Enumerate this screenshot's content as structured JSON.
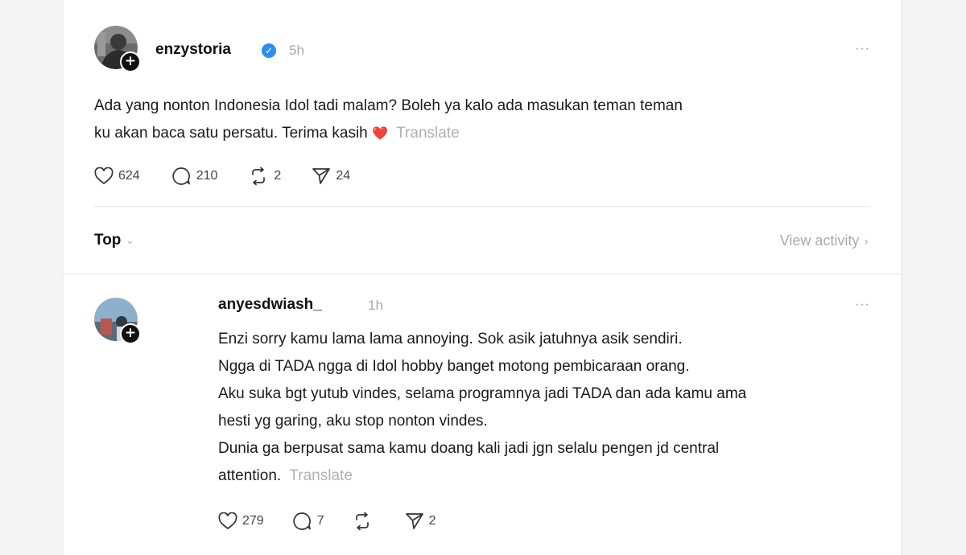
{
  "post": {
    "username": "enzystoria",
    "time": "5h",
    "text_lines": [
      "Ada yang nonton Indonesia Idol tadi malam? Boleh ya kalo ada masukan teman teman",
      "ku akan baca satu persatu. Terima kasih"
    ],
    "heart_emoji": "❤️",
    "translate": "Translate",
    "likes": "624",
    "replies": "210",
    "reposts": "2",
    "shares": "24",
    "more": "···"
  },
  "sort": {
    "label": "Top",
    "chevron": "⌵"
  },
  "view_activity": {
    "label": "View activity",
    "chevron": "›"
  },
  "reply": {
    "username": "anyesdwiash_",
    "time": "1h",
    "text_lines": [
      "Enzi sorry kamu lama lama annoying. Sok asik jatuhnya asik sendiri.",
      "Ngga di TADA ngga di Idol hobby banget motong pembicaraan orang.",
      "Aku suka bgt yutub vindes, selama programnya jadi TADA dan ada kamu ama",
      "hesti yg garing, aku stop nonton vindes.",
      "Dunia ga berpusat sama kamu doang kali jadi jgn selalu pengen jd central",
      "attention."
    ],
    "translate": "Translate",
    "likes": "279",
    "replies": "7",
    "reposts": "",
    "shares": "2",
    "more": "···"
  },
  "icons": {
    "like": "heart-outline-icon",
    "reply": "speech-bubble-icon",
    "repost": "repost-arrows-icon",
    "share": "paper-plane-icon",
    "verified": "verified-check-icon"
  },
  "colors": {
    "verified": "#2f8df2",
    "muted": "#a9a9a9",
    "heart_emoji": "#e23b4a"
  }
}
